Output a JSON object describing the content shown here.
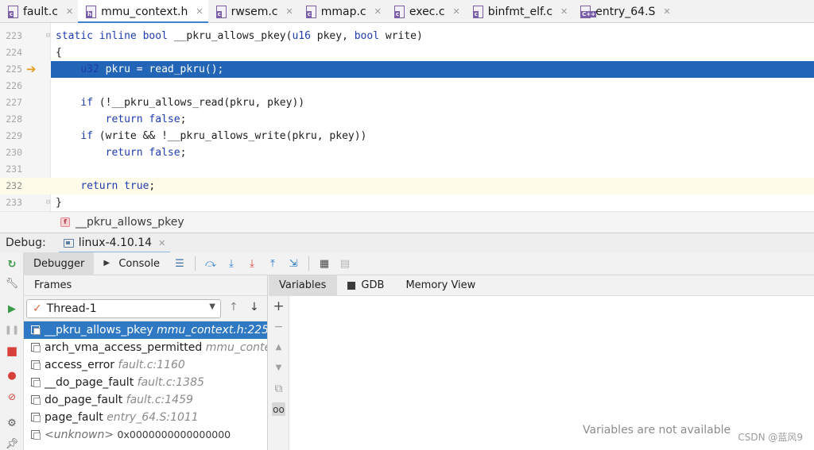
{
  "tabs": [
    {
      "label": "fault.c",
      "icon": "c-file-icon",
      "letter": "c",
      "active": false
    },
    {
      "label": "mmu_context.h",
      "icon": "c-file-icon",
      "letter": "h",
      "active": true
    },
    {
      "label": "rwsem.c",
      "icon": "c-file-icon",
      "letter": "c",
      "active": false
    },
    {
      "label": "mmap.c",
      "icon": "c-file-icon",
      "letter": "c",
      "active": false
    },
    {
      "label": "exec.c",
      "icon": "c-file-icon",
      "letter": "c",
      "active": false
    },
    {
      "label": "binfmt_elf.c",
      "icon": "c-file-icon",
      "letter": "c",
      "active": false
    },
    {
      "label": "entry_64.S",
      "icon": "asm-file-icon",
      "letter": "C++",
      "active": false
    }
  ],
  "editor": {
    "lines": [
      {
        "num": "223",
        "code": "static inline bool __pkru_allows_pkey(u16 pkey, bool write)"
      },
      {
        "num": "224",
        "code": "{"
      },
      {
        "num": "225",
        "code": "    u32 pkru = read_pkru();",
        "exec": true
      },
      {
        "num": "226",
        "code": ""
      },
      {
        "num": "227",
        "code": "    if (!__pkru_allows_read(pkru, pkey))"
      },
      {
        "num": "228",
        "code": "        return false;"
      },
      {
        "num": "229",
        "code": "    if (write && !__pkru_allows_write(pkru, pkey))"
      },
      {
        "num": "230",
        "code": "        return false;"
      },
      {
        "num": "231",
        "code": ""
      },
      {
        "num": "232",
        "code": "    return true;",
        "current": true
      },
      {
        "num": "233",
        "code": "}"
      }
    ],
    "breadcrumb": "__pkru_allows_pkey",
    "breadcrumb_badge": "f"
  },
  "debug": {
    "label": "Debug:",
    "session": "linux-4.10.14",
    "tabs": {
      "debugger": "Debugger",
      "console": "Console"
    },
    "frames_header": "Frames",
    "thread": "Thread-1",
    "frames": [
      {
        "func": "__pkru_allows_pkey",
        "loc": "mmu_context.h:225",
        "selected": true
      },
      {
        "func": "arch_vma_access_permitted",
        "loc": "mmu_context.h"
      },
      {
        "func": "access_error",
        "loc": "fault.c:1160"
      },
      {
        "func": "__do_page_fault",
        "loc": "fault.c:1385"
      },
      {
        "func": "do_page_fault",
        "loc": "fault.c:1459"
      },
      {
        "func": "page_fault",
        "loc": "entry_64.S:1011"
      },
      {
        "func": "<unknown>",
        "loc": "0x0000000000000000",
        "unknown": true
      }
    ],
    "var_tabs": {
      "variables": "Variables",
      "gdb": "GDB",
      "memory": "Memory View"
    },
    "vars_empty": "Variables are not available"
  },
  "watermark": "CSDN @蓝风9",
  "colors": {
    "exec_line": "#2265b6",
    "selected_frame": "#2f78c4",
    "keyword": "#1f3cae",
    "resume_green": "#3c9a4a",
    "stop_red": "#d8403b"
  }
}
